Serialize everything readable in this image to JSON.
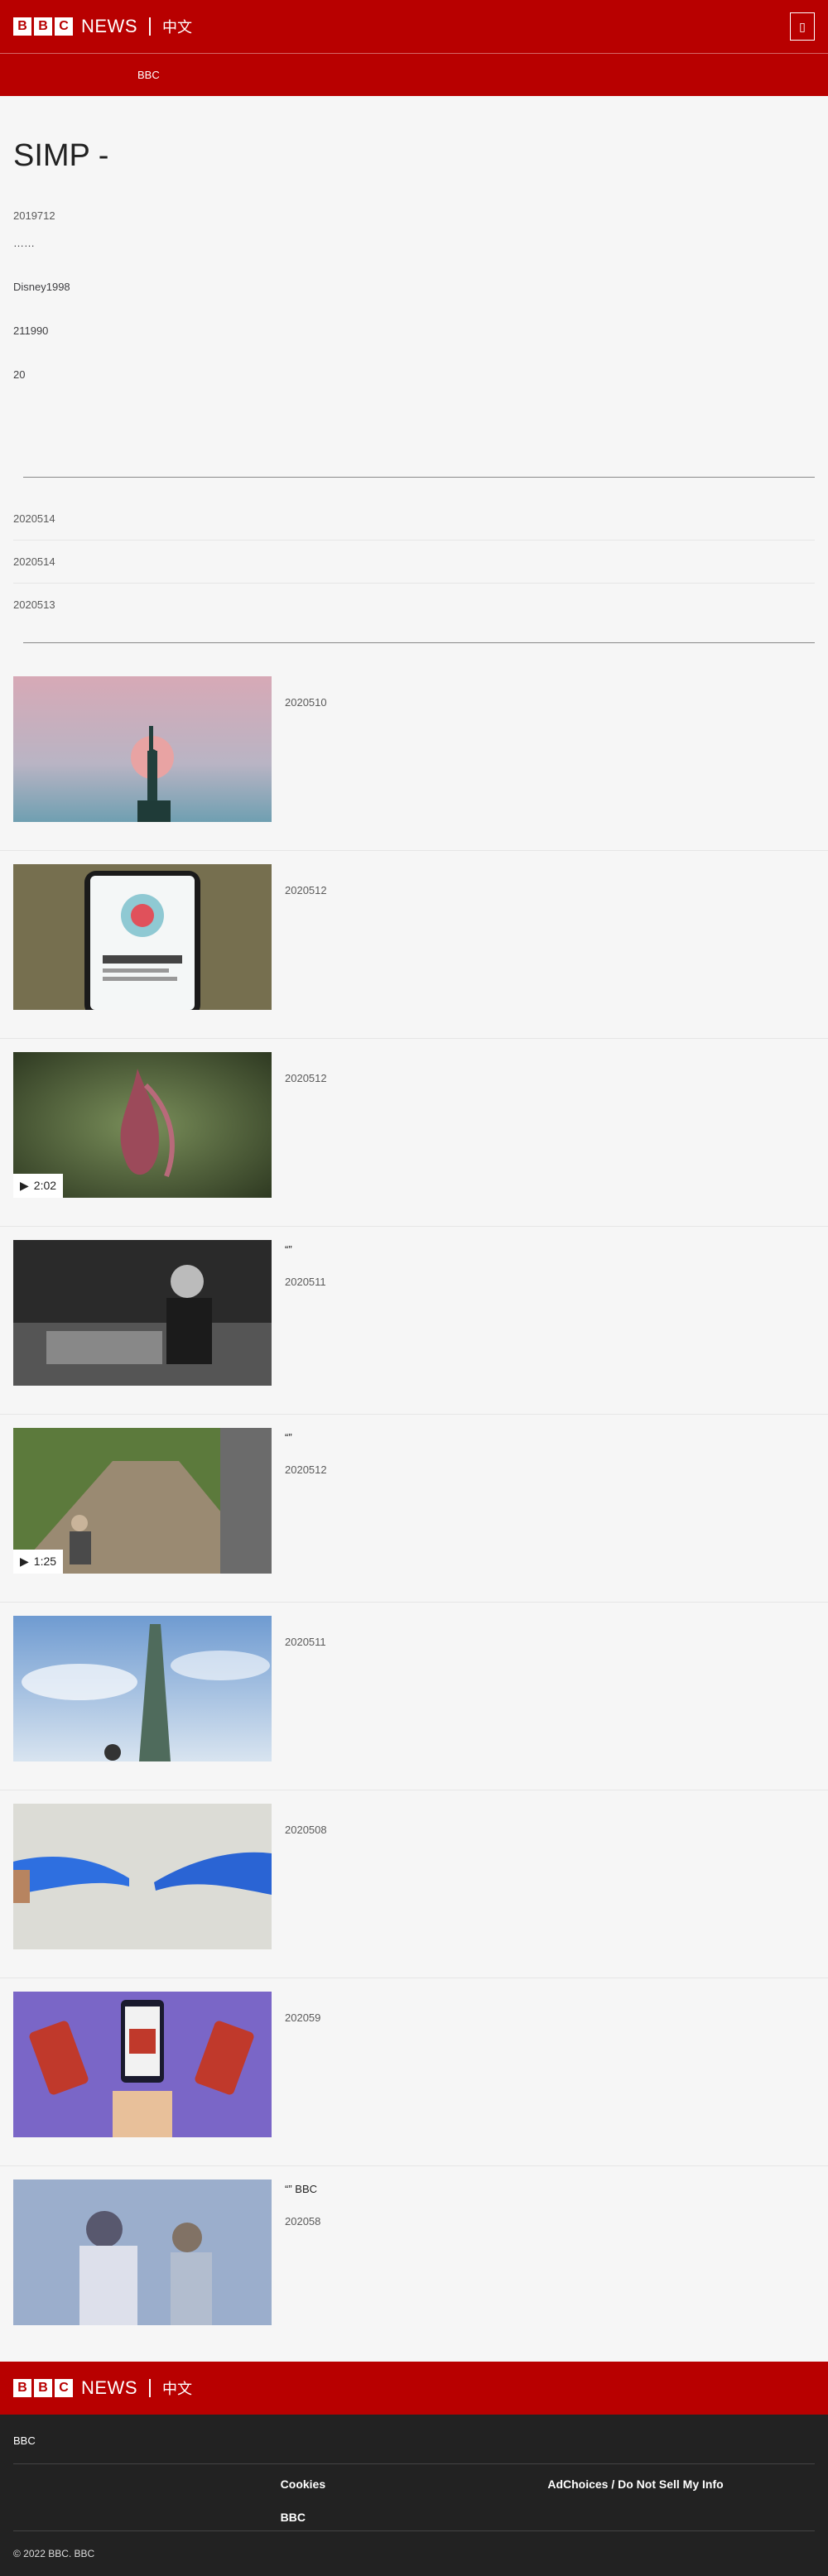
{
  "header": {
    "logo_letters": [
      "B",
      "B",
      "C"
    ],
    "brand_news": "NEWS",
    "brand_lang": "中文",
    "menu_icon": "menu-icon"
  },
  "nav": {
    "items": [
      "",
      "",
      "",
      "",
      "",
      "",
      "",
      "BBC"
    ]
  },
  "article": {
    "title": "SIMP - ",
    "date": "2019712",
    "paragraphs": [
      "……",
      "Disney1998",
      "211990",
      "20"
    ]
  },
  "sections": {
    "latest_title": "",
    "latest": [
      {
        "title": "",
        "date": "2020514"
      },
      {
        "title": "",
        "date": "2020514"
      },
      {
        "title": " ",
        "date": "2020513"
      }
    ],
    "features_title": "",
    "features": [
      {
        "title": "",
        "date": "2020510",
        "image": "statue-of-liberty-moon",
        "video": ""
      },
      {
        "title": "",
        "date": "2020512",
        "image": "coronavirus-phone",
        "video": ""
      },
      {
        "title": "",
        "date": "2020512",
        "image": "plant-roots",
        "video": "2:02"
      },
      {
        "title": "“”",
        "date": "2020511",
        "image": "vintage-scientist",
        "video": ""
      },
      {
        "title": " “”",
        "date": "2020512",
        "image": "motorcycle-road",
        "video": "1:25"
      },
      {
        "title": "",
        "date": "2020511",
        "image": "taipei-101",
        "video": ""
      },
      {
        "title": "",
        "date": "2020508",
        "image": "gloved-hands",
        "video": ""
      },
      {
        "title": "",
        "date": "202059",
        "image": "phones-illustration",
        "video": ""
      },
      {
        "title": "“” BBC",
        "date": "202058",
        "image": "crowd-blur",
        "video": ""
      }
    ]
  },
  "footer": {
    "brand_news": "NEWS",
    "brand_lang": "中文",
    "intro": "BBC",
    "links": [
      "",
      "Cookies",
      "AdChoices / Do Not Sell My Info",
      "",
      "BBC",
      ""
    ],
    "copyright": "© 2022 BBC. BBC "
  }
}
